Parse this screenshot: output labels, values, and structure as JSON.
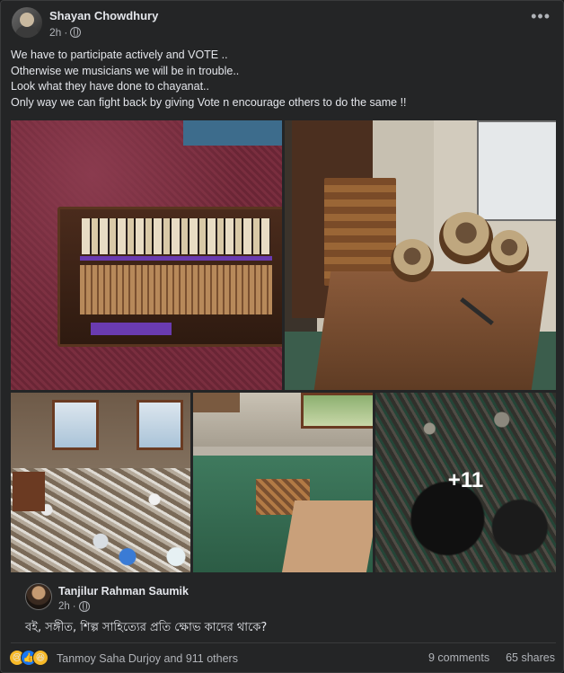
{
  "post": {
    "author": "Shayan Chowdhury",
    "time": "2h",
    "privacy_icon": "globe-icon",
    "more_label": "•••",
    "text_lines": [
      "We have to participate actively and VOTE ..",
      "Otherwise we musicians we will be in trouble..",
      "Look what they have done to chayanat..",
      "Only way we can fight back by giving Vote n encourage others to do the same !!"
    ]
  },
  "photos": {
    "more_count": "+11"
  },
  "comment": {
    "author": "Tanjilur Rahman Saumik",
    "time": "2h",
    "text": "বই, সঙ্গীত, শিল্প সাহিত্যের প্রতি ক্ষোভ কাদের থাকে?"
  },
  "reactions": {
    "icons": [
      "sad-reaction-icon",
      "like-reaction-icon",
      "haha-reaction-icon"
    ],
    "summary": "Tanmoy Saha Durjoy and 911 others",
    "comments": "9 comments",
    "shares": "65 shares"
  }
}
